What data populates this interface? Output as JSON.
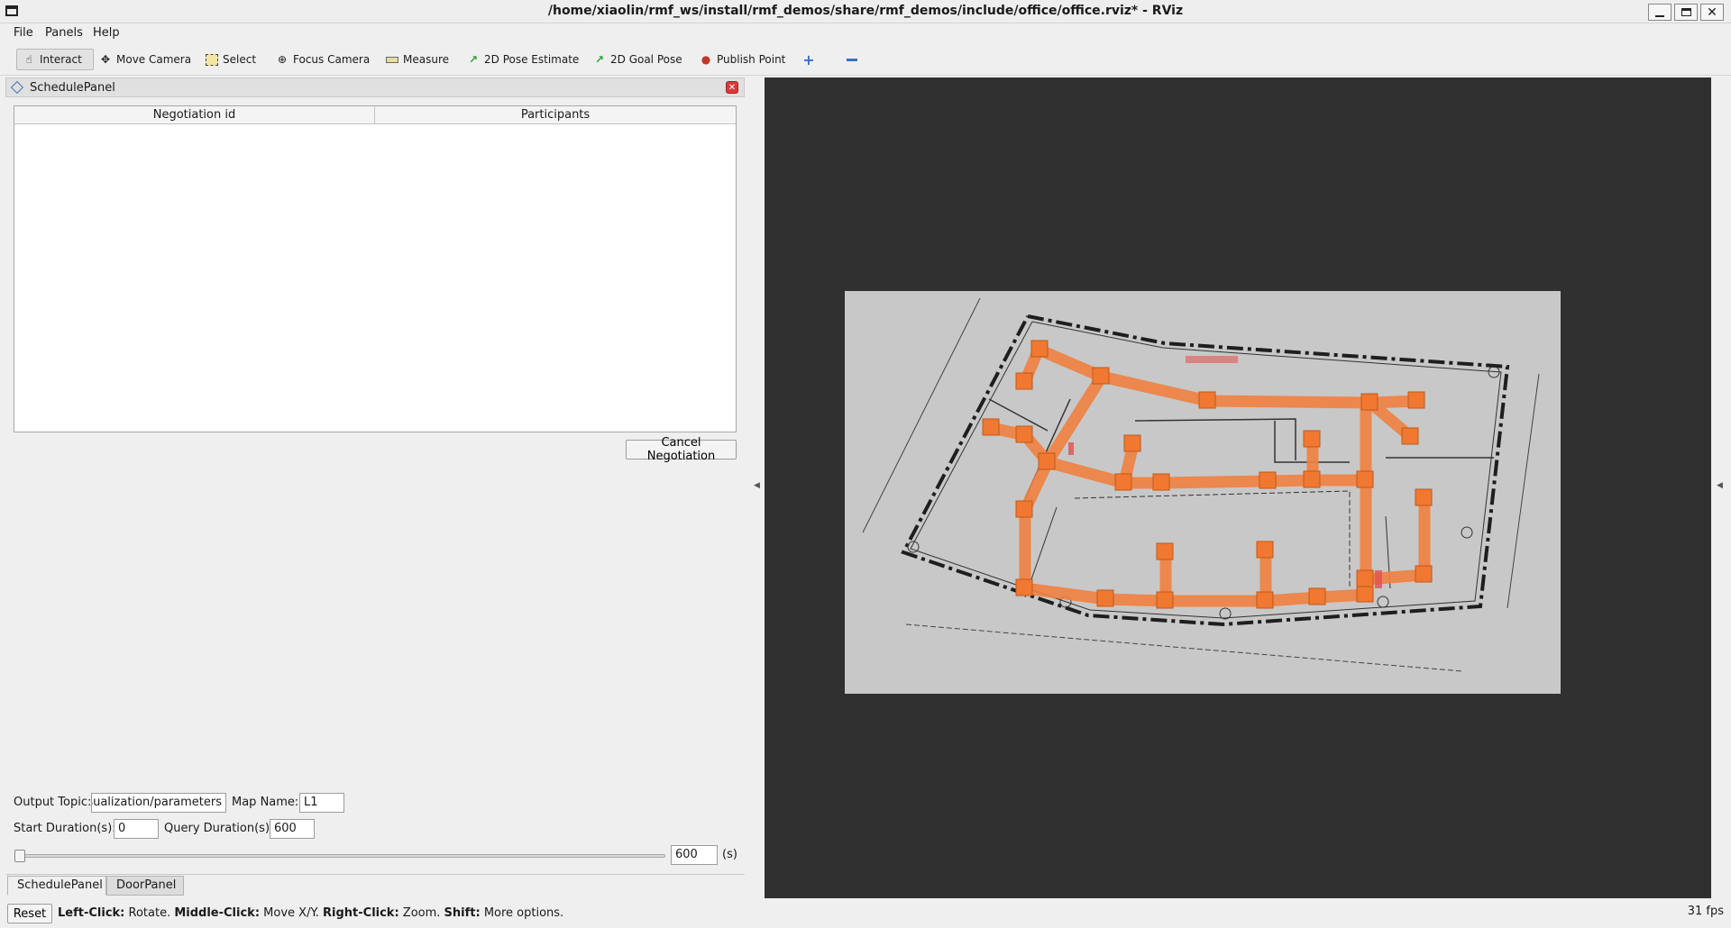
{
  "window": {
    "title": "/home/xiaolin/rmf_ws/install/rmf_demos/share/rmf_demos/include/office/office.rviz* - RViz",
    "buttons": [
      "minimize",
      "maximize",
      "close"
    ]
  },
  "menubar": {
    "items": [
      {
        "label": "File"
      },
      {
        "label": "Panels"
      },
      {
        "label": "Help"
      }
    ]
  },
  "toolbar": {
    "tools": [
      {
        "label": "Interact",
        "icon": "hand-icon",
        "active": true
      },
      {
        "label": "Move Camera",
        "icon": "move-camera-icon"
      },
      {
        "label": "Select",
        "icon": "select-icon"
      },
      {
        "label": "Focus Camera",
        "icon": "focus-camera-icon"
      },
      {
        "label": "Measure",
        "icon": "measure-icon"
      },
      {
        "label": "2D Pose Estimate",
        "icon": "pose-estimate-arrow-icon"
      },
      {
        "label": "2D Goal Pose",
        "icon": "goal-pose-arrow-icon"
      },
      {
        "label": "Publish Point",
        "icon": "map-pin-icon"
      }
    ],
    "extra_icons": [
      "plus-icon",
      "minus-icon"
    ]
  },
  "schedule_panel": {
    "title": "SchedulePanel",
    "table": {
      "columns": [
        "Negotiation id",
        "Participants"
      ],
      "rows": []
    },
    "cancel_button": "Cancel Negotiation",
    "output_topic": {
      "label": "Output Topic:",
      "value": "visualization/parameters"
    },
    "map_name": {
      "label": "Map Name:",
      "value": "L1"
    },
    "start_duration": {
      "label": "Start Duration(s):",
      "value": "0"
    },
    "query_duration": {
      "label": "Query Duration(s):",
      "value": "600"
    },
    "slider": {
      "value": 0,
      "max": 600,
      "field_value": "600",
      "unit": "(s)"
    }
  },
  "bottom_tabs": [
    {
      "label": "SchedulePanel",
      "active": true
    },
    {
      "label": "DoorPanel",
      "active": false
    }
  ],
  "status": {
    "reset_button": "Reset",
    "hint_parts": [
      {
        "text": "Left-Click:",
        "bold": true
      },
      {
        "text": " Rotate. ",
        "bold": false
      },
      {
        "text": "Middle-Click:",
        "bold": true
      },
      {
        "text": " Move X/Y. ",
        "bold": false
      },
      {
        "text": "Right-Click:",
        "bold": true
      },
      {
        "text": " Zoom. ",
        "bold": false
      },
      {
        "text": "Shift:",
        "bold": true
      },
      {
        "text": " More options.",
        "bold": false
      }
    ],
    "fps": "31 fps"
  },
  "colors": {
    "viewport_bg": "#303030",
    "lane": "#f08040",
    "waypoint": "#f07830",
    "close_red": "#d63a3a"
  }
}
